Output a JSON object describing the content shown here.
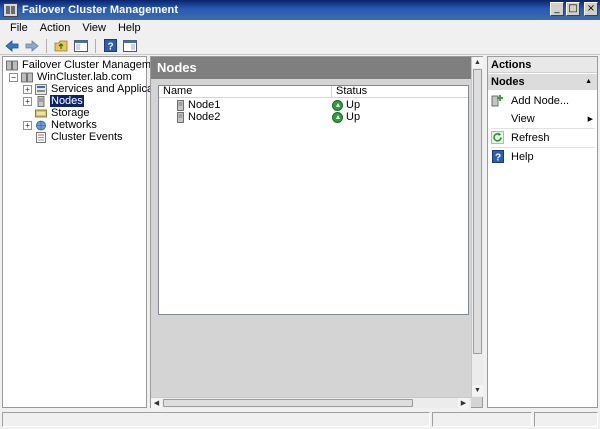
{
  "window": {
    "title": "Failover Cluster Management"
  },
  "menu": {
    "file": "File",
    "action": "Action",
    "view": "View",
    "help": "Help"
  },
  "toolbar": {
    "icons": [
      "back-arrow-icon",
      "forward-arrow-icon",
      "up-folder-icon",
      "show-tree-icon",
      "help-icon",
      "show-action-pane-icon"
    ]
  },
  "tree": {
    "root": "Failover Cluster Management",
    "cluster": "WinCluster.lab.com",
    "items": {
      "services": "Services and Applications",
      "nodes": "Nodes",
      "storage": "Storage",
      "networks": "Networks",
      "events": "Cluster Events"
    }
  },
  "center": {
    "title": "Nodes",
    "columns": {
      "name": "Name",
      "status": "Status"
    },
    "rows": [
      {
        "name": "Node1",
        "status": "Up"
      },
      {
        "name": "Node2",
        "status": "Up"
      }
    ]
  },
  "actions": {
    "header": "Actions",
    "section": "Nodes",
    "items": {
      "add_node": "Add Node...",
      "view": "View",
      "refresh": "Refresh",
      "help": "Help"
    }
  },
  "colors": {
    "title_bar": "#0a246a",
    "selected": "#0a246a",
    "header": "#7f7f7f",
    "status_up": "#2f9e3f"
  }
}
